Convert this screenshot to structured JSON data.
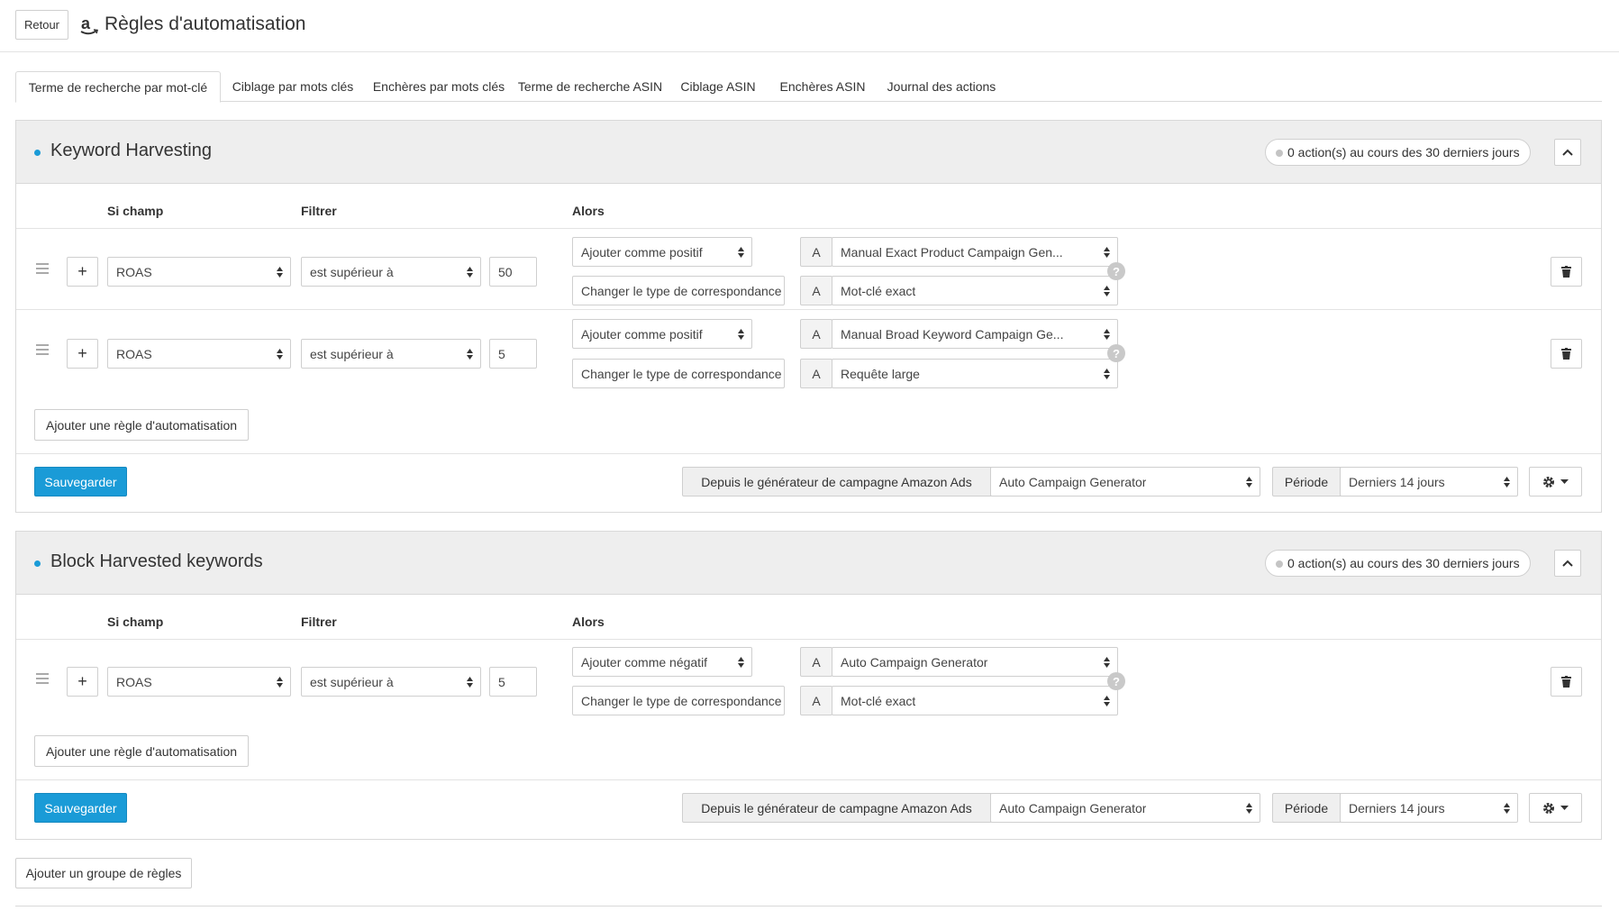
{
  "header": {
    "back_label": "Retour",
    "title": "Règles d'automatisation",
    "logo_icon": "amazon-logo-icon"
  },
  "tabs": [
    {
      "label": "Terme de recherche par mot-clé",
      "active": true
    },
    {
      "label": "Ciblage par mots clés",
      "active": false
    },
    {
      "label": "Enchères par mots clés",
      "active": false
    },
    {
      "label": "Terme de recherche ASIN",
      "active": false
    },
    {
      "label": "Ciblage ASIN",
      "active": false
    },
    {
      "label": "Enchères ASIN",
      "active": false
    },
    {
      "label": "Journal des actions",
      "active": false
    }
  ],
  "colors": {
    "accent": "#1a9bd7",
    "header_bg": "#eeeeee",
    "border": "#d9d9d9"
  },
  "columns": {
    "field": "Si champ",
    "filter": "Filtrer",
    "then": "Alors"
  },
  "groups": [
    {
      "title": "Keyword Harvesting",
      "actions_badge": "0 action(s) au cours des 30 derniers jours",
      "rules": [
        {
          "field": "ROAS",
          "filter": "est supérieur à",
          "value": "50",
          "action1": "Ajouter comme positif",
          "prefix1": "A",
          "target1": "Manual Exact Product Campaign Gen...",
          "action2": "Changer le type de correspondance",
          "prefix2": "A",
          "target2": "Mot-clé exact"
        },
        {
          "field": "ROAS",
          "filter": "est supérieur à",
          "value": "5",
          "action1": "Ajouter comme positif",
          "prefix1": "A",
          "target1": "Manual Broad Keyword Campaign Ge...",
          "action2": "Changer le type de correspondance",
          "prefix2": "A",
          "target2": "Requête large"
        }
      ],
      "add_rule_label": "Ajouter une règle d'automatisation",
      "save_label": "Sauvegarder",
      "source_label": "Depuis le générateur de campagne Amazon Ads",
      "source_value": "Auto Campaign Generator",
      "period_label": "Période",
      "period_value": "Derniers 14 jours"
    },
    {
      "title": "Block Harvested keywords",
      "actions_badge": "0 action(s) au cours des 30 derniers jours",
      "rules": [
        {
          "field": "ROAS",
          "filter": "est supérieur à",
          "value": "5",
          "action1": "Ajouter comme négatif",
          "prefix1": "A",
          "target1": "Auto Campaign Generator",
          "action2": "Changer le type de correspondance",
          "prefix2": "A",
          "target2": "Mot-clé exact"
        }
      ],
      "add_rule_label": "Ajouter une règle d'automatisation",
      "save_label": "Sauvegarder",
      "source_label": "Depuis le générateur de campagne Amazon Ads",
      "source_value": "Auto Campaign Generator",
      "period_label": "Période",
      "period_value": "Derniers 14 jours"
    }
  ],
  "add_group_label": "Ajouter un groupe de règles"
}
